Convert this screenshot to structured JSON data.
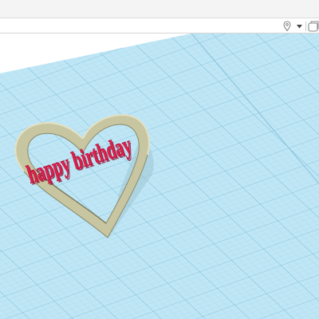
{
  "toolbar": {
    "icons": [
      "pin-icon",
      "chevron-down-icon",
      "snap-grid-icon"
    ]
  },
  "scene": {
    "shapes": [
      {
        "type": "heart-outline",
        "color": "#c8c6a0"
      },
      {
        "type": "3d-text",
        "text": "happy birthday",
        "color": "#e01f4b"
      }
    ],
    "workplane_color": "#bfe6f5"
  }
}
